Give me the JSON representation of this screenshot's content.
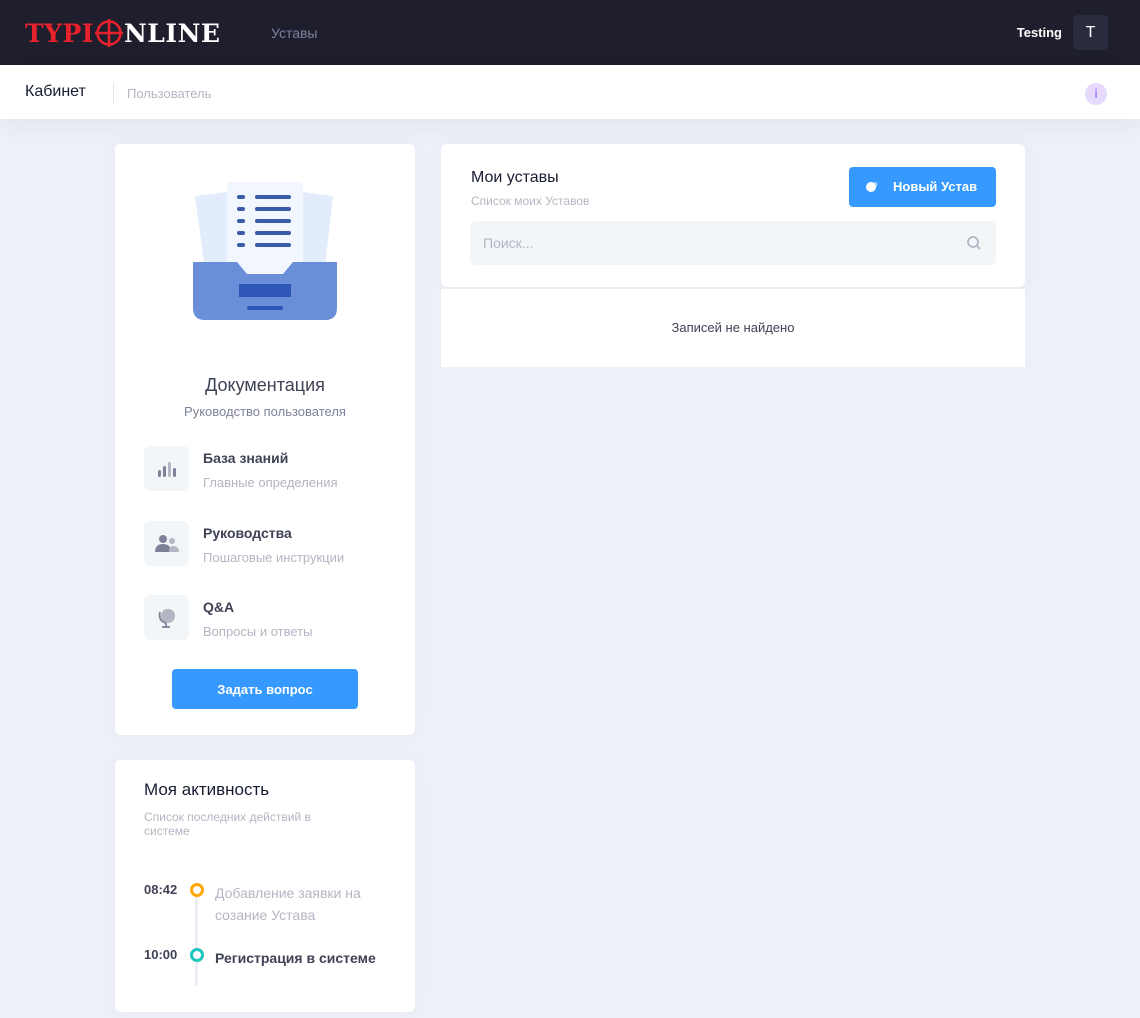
{
  "header": {
    "logo_left": "TYPI",
    "logo_right": "NLINE",
    "nav_item": "Уставы",
    "user_name": "Testing",
    "avatar_initial": "T"
  },
  "subheader": {
    "title": "Кабинет",
    "breadcrumb": "Пользователь",
    "info_label": "i"
  },
  "documentation": {
    "title": "Документация",
    "subtitle": "Руководство пользователя",
    "items": [
      {
        "title": "База знаний",
        "description": "Главные определения",
        "icon": "bar-chart-icon"
      },
      {
        "title": "Руководства",
        "description": "Пошаговые инструкции",
        "icon": "users-icon"
      },
      {
        "title": "Q&A",
        "description": "Вопросы и ответы",
        "icon": "globe-icon"
      }
    ],
    "ask_button": "Задать вопрос"
  },
  "activity": {
    "title": "Моя активность",
    "subtitle": "Список последних действий в системе",
    "events": [
      {
        "time": "08:42",
        "text": "Добавление заявки на созание Устава",
        "color": "#ffa800"
      },
      {
        "time": "10:00",
        "text": "Регистрация в системе",
        "color": "#1bc5bd"
      }
    ]
  },
  "ustavs": {
    "title": "Мои уставы",
    "subtitle": "Список моих Уставов",
    "new_button": "Новый Устав",
    "search_placeholder": "Поиск...",
    "empty_message": "Записей не найдено"
  },
  "colors": {
    "primary": "#3699ff",
    "header_bg": "#1e1e2d",
    "logo_red": "#e8222d",
    "page_bg": "#eef0f8"
  }
}
